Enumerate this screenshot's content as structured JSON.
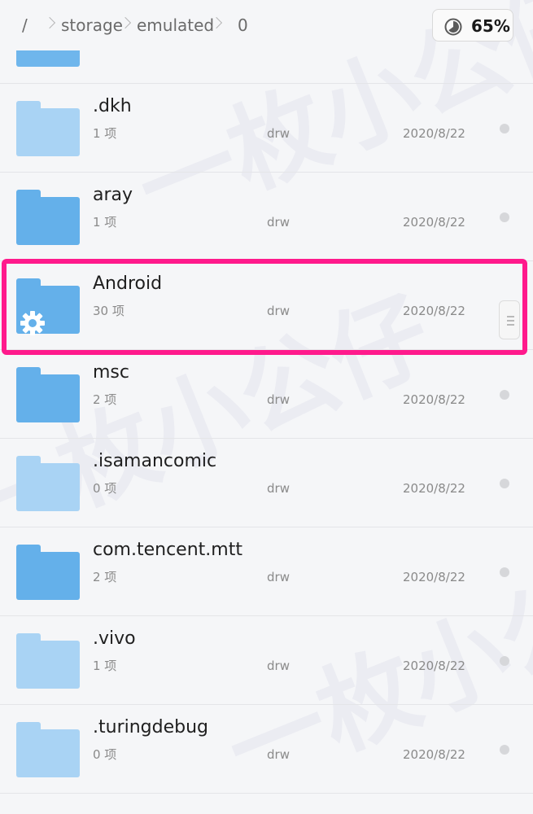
{
  "breadcrumb": {
    "root": "/",
    "items": [
      "storage",
      "emulated",
      "0"
    ]
  },
  "storage": {
    "percent_label": "65%",
    "percent_value": 65
  },
  "folders": [
    {
      "name": ".dkh",
      "count": "1 项",
      "perm": "drw",
      "date": "2020/8/22",
      "style": "light"
    },
    {
      "name": "aray",
      "count": "1 项",
      "perm": "drw",
      "date": "2020/8/22",
      "style": "dark"
    },
    {
      "name": "Android",
      "count": "30 项",
      "perm": "drw",
      "date": "2020/8/22",
      "style": "dark",
      "system": true
    },
    {
      "name": "msc",
      "count": "2 项",
      "perm": "drw",
      "date": "2020/8/22",
      "style": "dark"
    },
    {
      "name": ".isamancomic",
      "count": "0 项",
      "perm": "drw",
      "date": "2020/8/22",
      "style": "light"
    },
    {
      "name": "com.tencent.mtt",
      "count": "2 项",
      "perm": "drw",
      "date": "2020/8/22",
      "style": "dark"
    },
    {
      "name": ".vivo",
      "count": "1 项",
      "perm": "drw",
      "date": "2020/8/22",
      "style": "light"
    },
    {
      "name": ".turingdebug",
      "count": "0 项",
      "perm": "drw",
      "date": "2020/8/22",
      "style": "light"
    }
  ],
  "watermark": "一枚小公仔",
  "colors": {
    "highlight": "#ff1a8c",
    "folder_dark": "#64b0ea",
    "folder_light": "#a9d3f4"
  }
}
